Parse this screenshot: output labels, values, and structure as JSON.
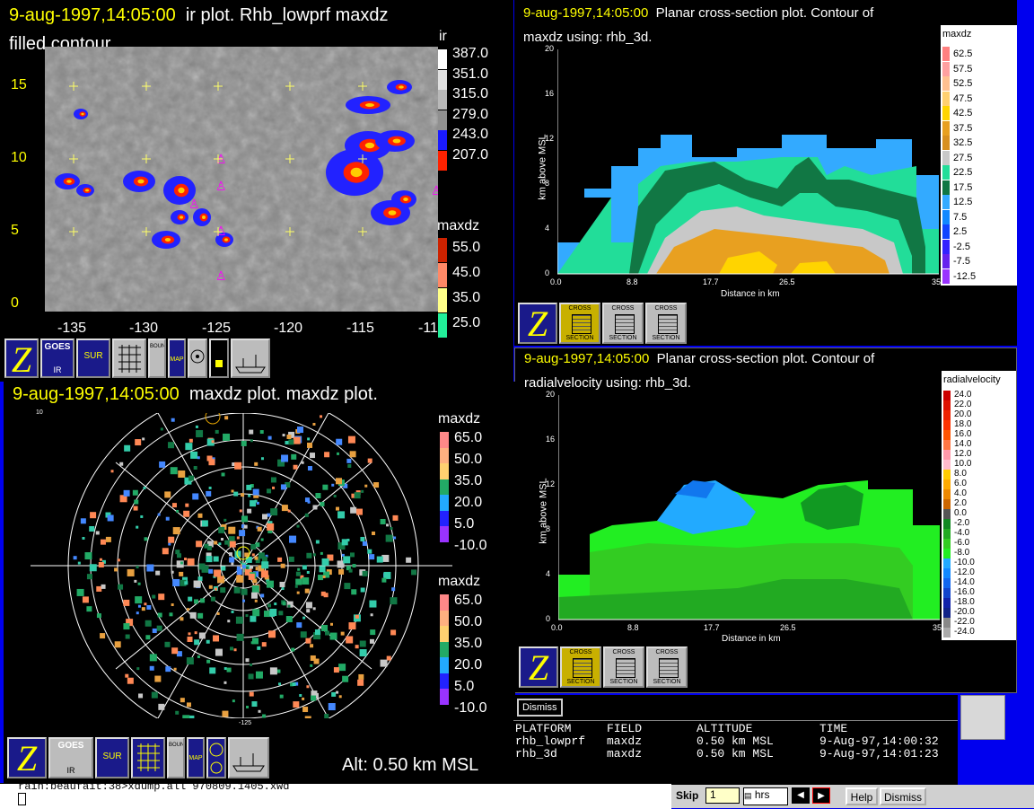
{
  "ir": {
    "timestamp": "9-aug-1997,14:05:00",
    "title_rest": "ir plot.  Rhb_lowprf maxdz",
    "title_line2": "filled contour.",
    "y_ticks": [
      "15",
      "10",
      "5",
      "0"
    ],
    "x_ticks": [
      "-135",
      "-130",
      "-125",
      "-120",
      "-115",
      "-11"
    ],
    "legend1_title": "ir",
    "legend1_labels": [
      "387.0",
      "351.0",
      "315.0",
      "279.0",
      "243.0",
      "207.0"
    ],
    "legend2_title": "maxdz",
    "legend2_labels": [
      "55.0",
      "45.0",
      "35.0",
      "25.0"
    ]
  },
  "toolbar_top": {
    "goes": "GOES",
    "ir": "IR",
    "sur": "SUR",
    "bounds": "BOUNDS",
    "map": "MAP"
  },
  "cs1": {
    "timestamp": "9-aug-1997,14:05:00",
    "title_rest": "Planar cross-section plot.  Contour of",
    "title_line2": "maxdz using: rhb_3d.",
    "legend_title": "maxdz",
    "legend_labels": [
      "62.5",
      "57.5",
      "52.5",
      "47.5",
      "42.5",
      "37.5",
      "32.5",
      "27.5",
      "22.5",
      "17.5",
      "12.5",
      "7.5",
      "2.5",
      "-2.5",
      "-7.5",
      "-12.5"
    ],
    "y_ticks": [
      "20",
      "16",
      "12",
      "8",
      "4",
      "0"
    ],
    "y_label": "km above MSL",
    "x_ticks": [
      "0.0",
      "8.8",
      "17.7",
      "26.5",
      "35"
    ],
    "x_label": "Distance in km",
    "buttons": [
      {
        "top": "CROSS",
        "bottom": "SECTION"
      },
      {
        "top": "CROSS",
        "bottom": "SECTION"
      },
      {
        "top": "CROSS",
        "bottom": "SECTION"
      }
    ]
  },
  "cs2": {
    "timestamp": "9-aug-1997,14:05:00",
    "title_rest": "Planar cross-section plot.  Contour of",
    "title_line2": "radialvelocity using: rhb_3d.",
    "legend_title": "radialvelocity",
    "legend_labels": [
      "24.0",
      "22.0",
      "20.0",
      "18.0",
      "16.0",
      "14.0",
      "12.0",
      "10.0",
      "8.0",
      "6.0",
      "4.0",
      "2.0",
      "0.0",
      "-2.0",
      "-4.0",
      "-6.0",
      "-8.0",
      "-10.0",
      "-12.0",
      "-14.0",
      "-16.0",
      "-18.0",
      "-20.0",
      "-22.0",
      "-24.0"
    ],
    "y_ticks": [
      "20",
      "16",
      "12",
      "8",
      "4",
      "0"
    ],
    "y_label": "km above MSL",
    "x_ticks": [
      "0.0",
      "8.8",
      "17.7",
      "26.5",
      "35"
    ],
    "x_label": "Distance in km",
    "buttons": [
      {
        "top": "CROSS",
        "bottom": "SECTION"
      },
      {
        "top": "CROSS",
        "bottom": "SECTION"
      },
      {
        "top": "CROSS",
        "bottom": "SECTION"
      }
    ]
  },
  "maxdz": {
    "timestamp": "9-aug-1997,14:05:00",
    "title_rest": "maxdz plot.  maxdz plot.",
    "corner_label": "10",
    "bottom_label": "-125",
    "legend1_title": "maxdz",
    "legend1_labels": [
      "65.0",
      "50.0",
      "35.0",
      "20.0",
      "5.0",
      "-10.0"
    ],
    "legend2_title": "maxdz",
    "legend2_labels": [
      "65.0",
      "50.0",
      "35.0",
      "20.0",
      "5.0",
      "-10.0"
    ],
    "alt_label": "Alt: 0.50 km MSL"
  },
  "info": {
    "dismiss": "Dismiss",
    "headers": [
      "PLATFORM",
      "FIELD",
      "ALTITUDE",
      "TIME"
    ],
    "rows": [
      [
        "rhb_lowprf",
        "maxdz",
        "0.50 km MSL",
        "9-Aug-97,14:00:32"
      ],
      [
        "rhb_3d",
        "maxdz",
        "0.50 km MSL",
        "9-Aug-97,14:01:23"
      ]
    ]
  },
  "terminal": {
    "text": "rain:beaufait:38>xdump.all 970809.1405.xwd"
  },
  "bottom_bar": {
    "skip": "Skip",
    "skip_value": "1",
    "hrs": "hrs",
    "help": "Help",
    "dismiss": "Dismiss"
  }
}
